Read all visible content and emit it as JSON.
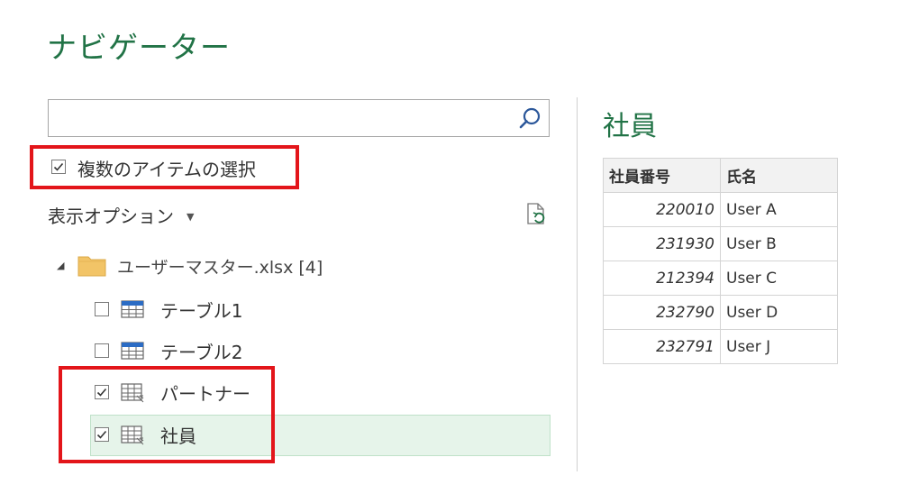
{
  "header": {
    "title": "ナビゲーター"
  },
  "search": {
    "value": "",
    "placeholder": ""
  },
  "multi_select": {
    "label": "複数のアイテムの選択",
    "checked": true
  },
  "view_options": {
    "label": "表示オプション"
  },
  "tree": {
    "file": {
      "label": "ユーザーマスター.xlsx [4]",
      "expanded": true
    },
    "items": [
      {
        "label": "テーブル1",
        "checked": false,
        "type": "table"
      },
      {
        "label": "テーブル2",
        "checked": false,
        "type": "table"
      },
      {
        "label": "パートナー",
        "checked": true,
        "type": "sheet"
      },
      {
        "label": "社員",
        "checked": true,
        "type": "sheet",
        "selected": true
      }
    ]
  },
  "preview": {
    "title": "社員",
    "columns": [
      "社員番号",
      "氏名"
    ],
    "rows": [
      [
        "220010",
        "User A"
      ],
      [
        "231930",
        "User B"
      ],
      [
        "212394",
        "User C"
      ],
      [
        "232790",
        "User D"
      ],
      [
        "232791",
        "User J"
      ]
    ]
  },
  "colors": {
    "accent": "#217346",
    "highlight": "#e3151a",
    "selected_bg": "#e6f4ea"
  }
}
